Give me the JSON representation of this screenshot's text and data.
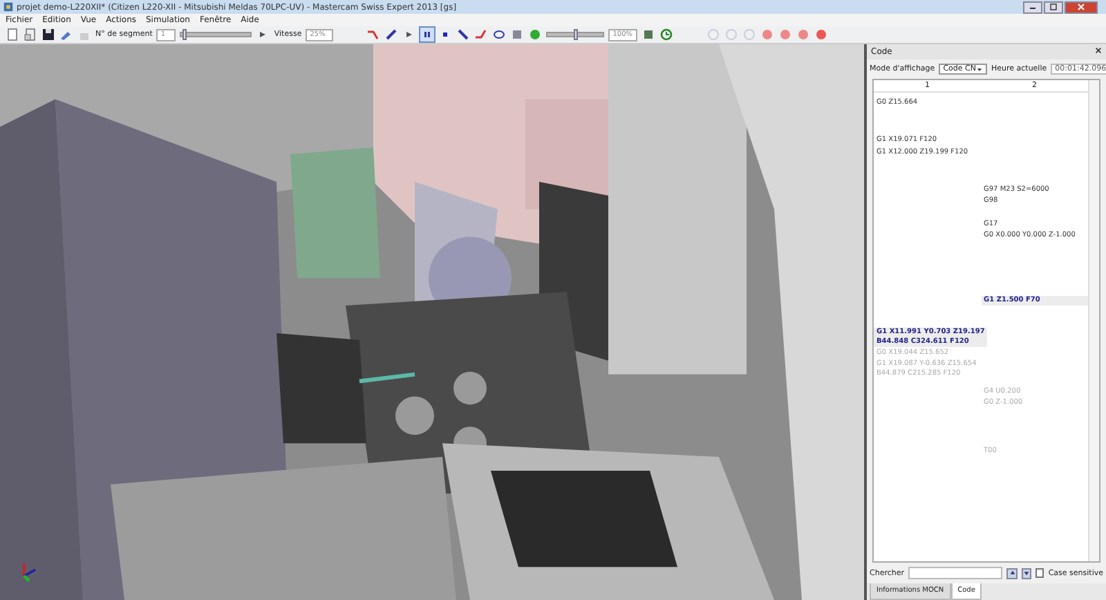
{
  "window": {
    "title": "projet demo-L220XII* (Citizen L220-XII - Mitsubishi Meldas 70LPC-UV) - Mastercam Swiss Expert 2013 [gs]"
  },
  "menu": [
    "Fichier",
    "Edition",
    "Vue",
    "Actions",
    "Simulation",
    "Fenêtre",
    "Aide"
  ],
  "toolbar": {
    "segment_label": "N° de segment",
    "segment_value": "1",
    "segment_slider": {
      "level": 0.03
    },
    "speed_label": "Vitesse",
    "speed_value": "25%",
    "zoom_slider": {
      "level": 0.5
    },
    "zoom_value": "100%",
    "pause_selected": true
  },
  "code_panel": {
    "title": "Code",
    "mode_label": "Mode d'affichage",
    "mode_value": "Code CN",
    "time_label": "Heure actuelle",
    "time_value": "00:01:42.096",
    "columns": [
      "1",
      "2"
    ],
    "rows": [
      {
        "kind": "past",
        "column_1": [
          "G0 Z15.664"
        ]
      },
      {
        "kind": "past",
        "column_1": [
          "G1 X19.071 F120"
        ]
      },
      {
        "kind": "past",
        "column_1": [
          "G1 X12.000 Z19.199 F120"
        ]
      },
      {
        "kind": "past",
        "column_2": [
          "G97 M23 S2=6000"
        ]
      },
      {
        "kind": "past",
        "column_2": [
          "G98"
        ]
      },
      {
        "kind": "past",
        "column_2": [
          "G17"
        ]
      },
      {
        "kind": "past",
        "column_2": [
          "G0 X0.000 Y0.000 Z-1.000"
        ]
      },
      {
        "kind": "current",
        "column_2": [
          "G1 Z1.500 F70"
        ]
      },
      {
        "kind": "current",
        "column_1": [
          "G1 X11.991 Y0.703 Z19.197",
          "B44.848 C324.611 F120"
        ]
      },
      {
        "kind": "future",
        "column_1": [
          "G0 X19.044 Z15.652"
        ]
      },
      {
        "kind": "future",
        "column_1": [
          "G1 X19.087 Y-0.636 Z15.654",
          "B44.879 C215.285 F120"
        ]
      },
      {
        "kind": "future",
        "column_2": [
          "G4 U0.200"
        ]
      },
      {
        "kind": "future",
        "column_2": [
          "G0 Z-1.000"
        ]
      },
      {
        "kind": "future",
        "column_2": [
          "T00"
        ]
      }
    ],
    "search_label": "Chercher",
    "case_sensitive": {
      "label": "Case sensitive",
      "checked": false
    },
    "tabs": [
      {
        "label": "Informations MOCN",
        "selected": false
      },
      {
        "label": "Code",
        "selected": true
      }
    ]
  }
}
